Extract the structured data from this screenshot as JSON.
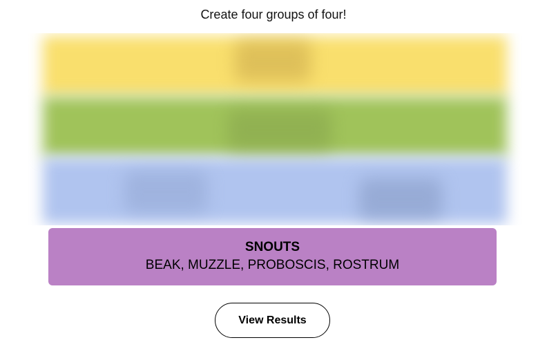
{
  "instructions": "Create four groups of four!",
  "colors": {
    "yellow": "#f9df6d",
    "green": "#a0c35a",
    "blue": "#b0c4ef",
    "purple": "#ba81c5"
  },
  "solved_group": {
    "title": "SNOUTS",
    "members": "BEAK, MUZZLE, PROBOSCIS, ROSTRUM",
    "color": "#ba81c5"
  },
  "buttons": {
    "view_results": "View Results"
  }
}
